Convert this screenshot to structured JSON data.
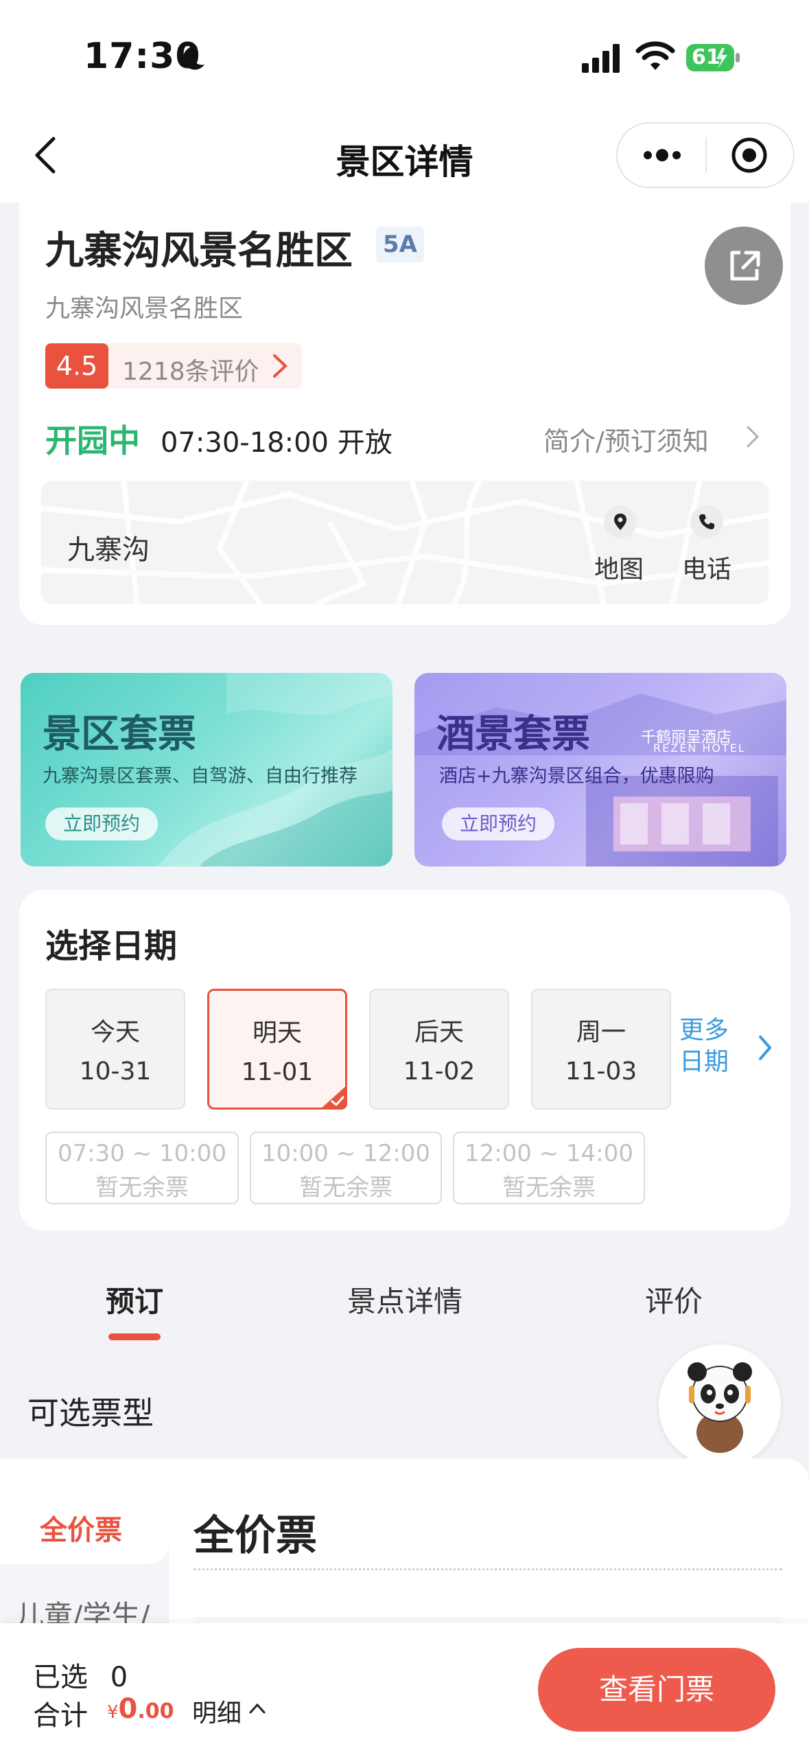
{
  "status_bar": {
    "time": "17:30",
    "battery": "61"
  },
  "nav": {
    "title": "景区详情"
  },
  "spot": {
    "name": "九寨沟风景名胜区",
    "level": "5A",
    "sub_name": "九寨沟风景名胜区",
    "rating": "4.5",
    "review_count": "1218条评价",
    "open_status": "开园中",
    "open_hours": "07:30-18:00 开放",
    "notice_link": "简介/预订须知",
    "map_location": "九寨沟",
    "map_label": "地图",
    "phone_label": "电话"
  },
  "banners": [
    {
      "title": "景区套票",
      "subtitle": "九寨沟景区套票、自驾游、自由行推荐",
      "button": "立即预约"
    },
    {
      "title": "酒景套票",
      "subtitle": "酒店+九寨沟景区组合，优惠限购",
      "button": "立即预约",
      "hotel_name": "千鹤丽呈酒店",
      "hotel_name_en": "REZEN HOTEL"
    }
  ],
  "date_picker": {
    "title": "选择日期",
    "dates": [
      {
        "label": "今天",
        "date": "10-31",
        "selected": false
      },
      {
        "label": "明天",
        "date": "11-01",
        "selected": true
      },
      {
        "label": "后天",
        "date": "11-02",
        "selected": false
      },
      {
        "label": "周一",
        "date": "11-03",
        "selected": false
      }
    ],
    "more_line1": "更多",
    "more_line2": "日期",
    "slots": [
      {
        "time": "07:30 ~ 10:00",
        "status": "暂无余票"
      },
      {
        "time": "10:00 ~ 12:00",
        "status": "暂无余票"
      },
      {
        "time": "12:00 ~ 14:00",
        "status": "暂无余票"
      }
    ]
  },
  "tabs": [
    {
      "label": "预订",
      "active": true
    },
    {
      "label": "景点详情",
      "active": false
    },
    {
      "label": "评价",
      "active": false
    }
  ],
  "ticket_section": {
    "title": "可选票型",
    "categories": [
      "全价票",
      "儿童/学生/"
    ],
    "active_category_title": "全价票"
  },
  "bottom_bar": {
    "selected_label": "已选",
    "selected_count": "0",
    "total_label": "合计",
    "currency": "¥",
    "total_int": "0",
    "total_dec": ".00",
    "detail_label": "明细",
    "cta": "查看门票"
  },
  "colors": {
    "accent": "#e9523f",
    "open_green": "#2bb673",
    "link_blue": "#3a9be0"
  }
}
